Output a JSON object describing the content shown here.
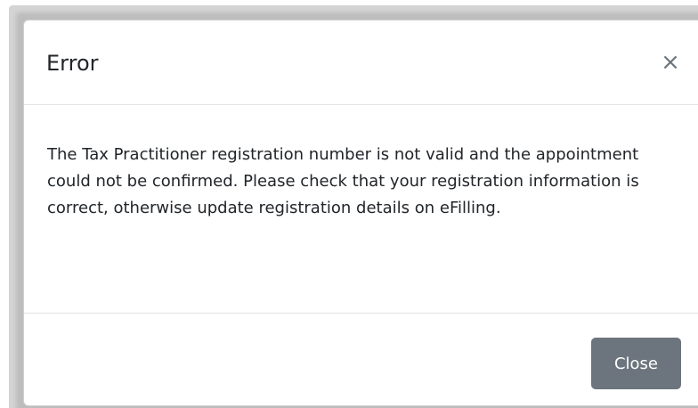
{
  "dialog": {
    "title": "Error",
    "close_icon_glyph": "×",
    "message": "The Tax Practitioner registration number is not valid and the appointment could not be confirmed. Please check that your registration information is correct, otherwise update registration details on eFilling.",
    "footer": {
      "close_label": "Close"
    }
  },
  "colors": {
    "button_secondary": "#6c757d",
    "text": "#212529",
    "divider": "#e3e3e3"
  }
}
